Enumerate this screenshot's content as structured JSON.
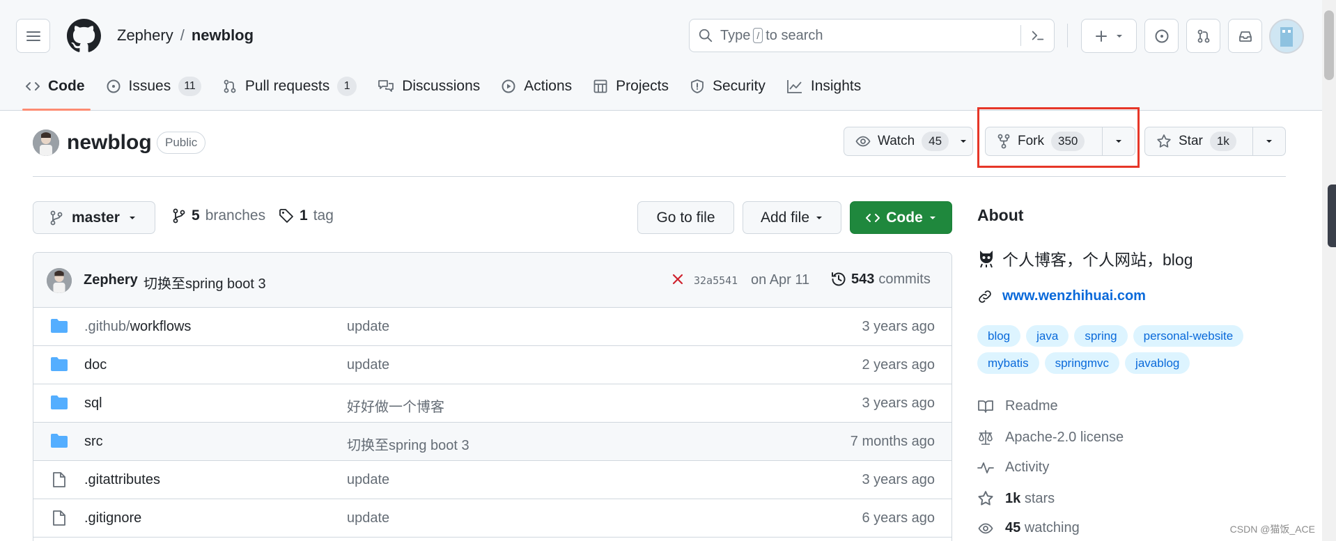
{
  "header": {
    "owner": "Zephery",
    "separator": "/",
    "repo": "newblog",
    "search_text_before": "Type",
    "search_key": "/",
    "search_text_after": "to search"
  },
  "tabs": [
    {
      "label": "Code",
      "icon": "code-icon"
    },
    {
      "label": "Issues",
      "count": "11",
      "icon": "issue-icon"
    },
    {
      "label": "Pull requests",
      "count": "1",
      "icon": "pull-request-icon"
    },
    {
      "label": "Discussions",
      "icon": "discussions-icon"
    },
    {
      "label": "Actions",
      "icon": "play-icon"
    },
    {
      "label": "Projects",
      "icon": "table-icon"
    },
    {
      "label": "Security",
      "icon": "shield-icon"
    },
    {
      "label": "Insights",
      "icon": "graph-icon"
    }
  ],
  "repo": {
    "name": "newblog",
    "visibility": "Public",
    "watch_label": "Watch",
    "watch_count": "45",
    "fork_label": "Fork",
    "fork_count": "350",
    "star_label": "Star",
    "star_count": "1k"
  },
  "toolbar": {
    "branch": "master",
    "branches_count": "5",
    "branches_label": "branches",
    "tags_count": "1",
    "tags_label": "tag",
    "go_to_file": "Go to file",
    "add_file": "Add file",
    "code": "Code"
  },
  "commit": {
    "author": "Zephery",
    "message": "切换至spring boot 3",
    "sha": "32a5541",
    "date": "on Apr 11",
    "count": "543",
    "count_label": "commits"
  },
  "files": [
    {
      "type": "dir",
      "name_dim": ".github/",
      "name": "workflows",
      "message": "update",
      "age": "3 years ago"
    },
    {
      "type": "dir",
      "name_dim": "",
      "name": "doc",
      "message": "update",
      "age": "2 years ago"
    },
    {
      "type": "dir",
      "name_dim": "",
      "name": "sql",
      "message": "好好做一个博客",
      "age": "3 years ago"
    },
    {
      "type": "dir",
      "name_dim": "",
      "name": "src",
      "message": "切换至spring boot 3",
      "age": "7 months ago"
    },
    {
      "type": "file",
      "name_dim": "",
      "name": ".gitattributes",
      "message": "update",
      "age": "3 years ago"
    },
    {
      "type": "file",
      "name_dim": "",
      "name": ".gitignore",
      "message": "update",
      "age": "6 years ago"
    }
  ],
  "about": {
    "title": "About",
    "description": "个人博客，个人网站，blog",
    "website": "www.wenzhihuai.com",
    "topics": [
      "blog",
      "java",
      "spring",
      "personal-website",
      "mybatis",
      "springmvc",
      "javablog"
    ],
    "readme": "Readme",
    "license": "Apache-2.0 license",
    "activity": "Activity",
    "stars_count": "1k",
    "stars_label": "stars",
    "watching_count": "45",
    "watching_label": "watching"
  },
  "watermark": "CSDN @猫饭_ACE",
  "colors": {
    "accent_blue": "#0969da",
    "code_green": "#1f883d",
    "tab_underline": "#fd8c73",
    "highlight_red": "#e63628",
    "folder_blue": "#54aeff"
  }
}
